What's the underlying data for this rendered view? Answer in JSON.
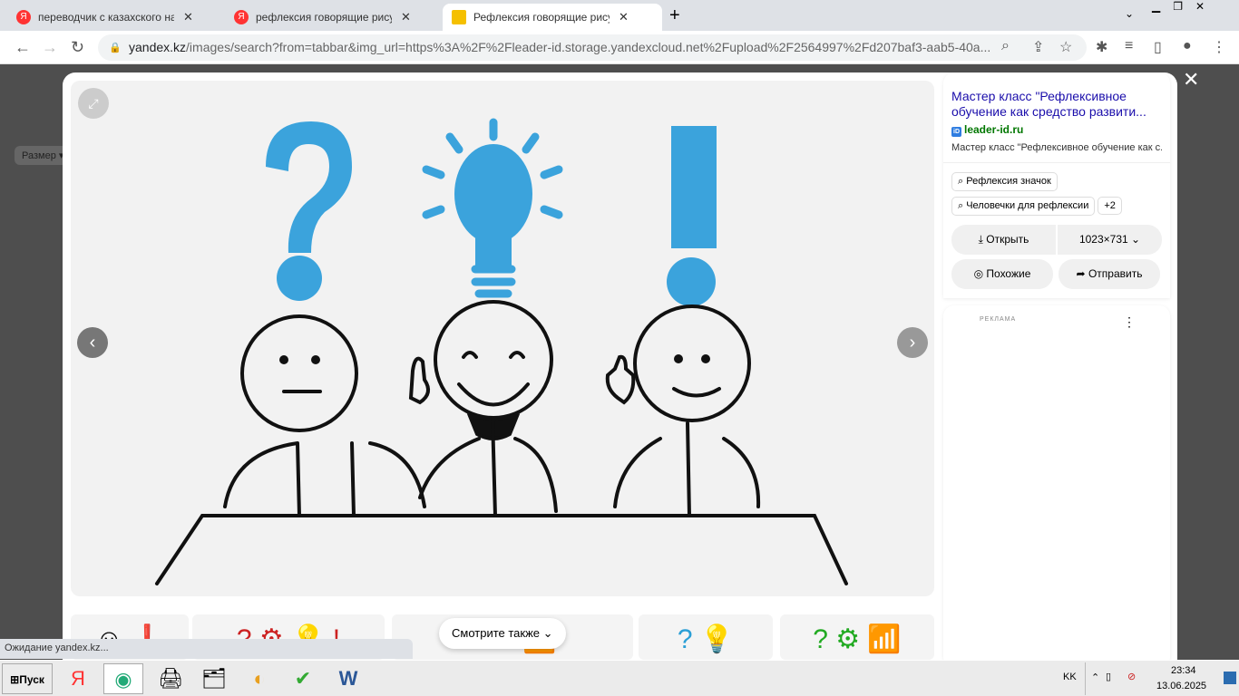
{
  "tabs": [
    {
      "label": "переводчик с казахского на русский",
      "icon": "yandex-icon"
    },
    {
      "label": "рефлексия говорящие рисунки — Яндекс",
      "icon": "yandex-icon"
    },
    {
      "label": "Рефлексия говорящие рисунки: смотрите",
      "icon": "image-icon"
    }
  ],
  "address": {
    "domain": "yandex.kz",
    "path": "/images/search?from=tabbar&img_url=https%3A%2F%2Fleader-id.storage.yandexcloud.net%2Fupload%2F2564997%2Fd207baf3-aab5-40a..."
  },
  "sidebar_filter": "Размер",
  "result": {
    "title": "Мастер класс \"Рефлексивное обучение как средство развити...",
    "site": "leader-id.ru",
    "description": "Мастер класс \"Рефлексивное обучение как с...",
    "chips": [
      "Рефлексия значок",
      "Человечки для рефлексии",
      "+2"
    ],
    "open": "Открыть",
    "size": "1023×731",
    "similar": "Похожие",
    "share": "Отправить"
  },
  "ad_label": "РЕКЛАМА",
  "see_also": "Смотрите также",
  "status": "Ожидание yandex.kz...",
  "taskbar": {
    "start": "Пуск",
    "lang": "KK",
    "time": "23:34",
    "date": "13.06.2025"
  }
}
